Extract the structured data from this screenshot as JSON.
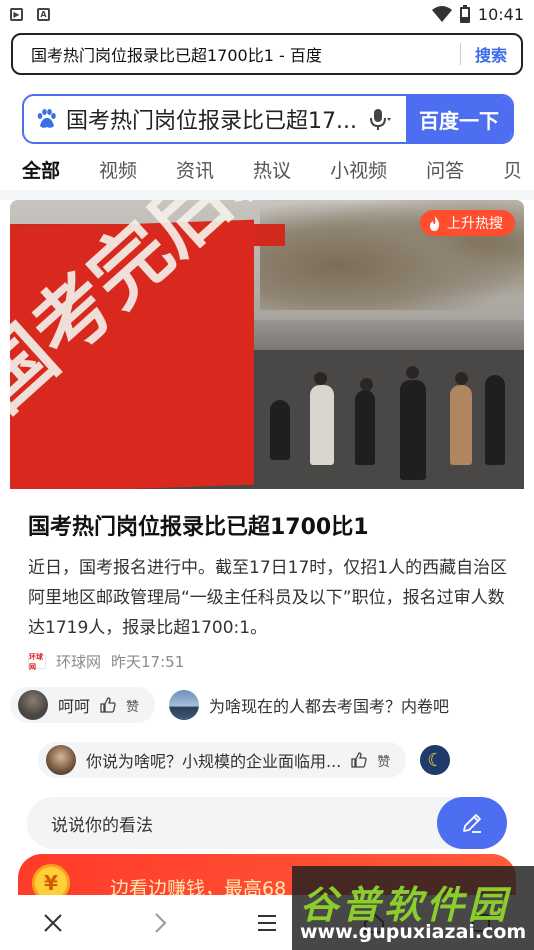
{
  "status_bar": {
    "time": "10:41"
  },
  "address_bar": {
    "url_text": "国考热门岗位报录比已超1700比1 - 百度",
    "search_label": "搜索"
  },
  "search": {
    "query": "国考热门岗位报录比已超17...",
    "button_label": "百度一下"
  },
  "tabs": [
    {
      "label": "全部",
      "active": true
    },
    {
      "label": "视频"
    },
    {
      "label": "资讯"
    },
    {
      "label": "热议"
    },
    {
      "label": "小视频"
    },
    {
      "label": "问答"
    },
    {
      "label": "贝"
    }
  ],
  "card": {
    "badge": "上升热搜",
    "banner_text": "国考完后就去",
    "title": "国考热门岗位报录比已超1700比1",
    "description": "近日，国考报名进行中。截至17日17时，仅招1人的西藏自治区阿里地区邮政管理局“一级主任科员及以下”职位，报名过审人数达1719人，报录比超1700:1。",
    "source_logo": "环球网",
    "source_name": "环球网",
    "time": "昨天17:51"
  },
  "comments_row1": [
    {
      "text": "呵呵",
      "like_label": "赞"
    },
    {
      "text": "为啥现在的人都去考国考？内卷吧"
    }
  ],
  "comments_row2": [
    {
      "text": "你说为啥呢？小规模的企业面临用...",
      "like_label": "赞"
    }
  ],
  "comment_input": {
    "placeholder": "说说你的看法"
  },
  "promo": {
    "text": "边看边赚钱，最高68",
    "coin_symbol": "¥"
  },
  "watermark": {
    "title": "谷普软件园",
    "url": "www.gupuxiazai.com"
  },
  "colors": {
    "accent": "#4e6ef2",
    "hot_badge": "#ff4d2e",
    "promo": "#ff3b2a"
  },
  "icons": [
    "play-icon",
    "a-icon",
    "wifi-icon",
    "battery-icon",
    "paw-icon",
    "mic-icon",
    "fire-icon",
    "thumb-up-icon",
    "pencil-icon",
    "close-icon",
    "forward-icon",
    "menu-icon"
  ]
}
